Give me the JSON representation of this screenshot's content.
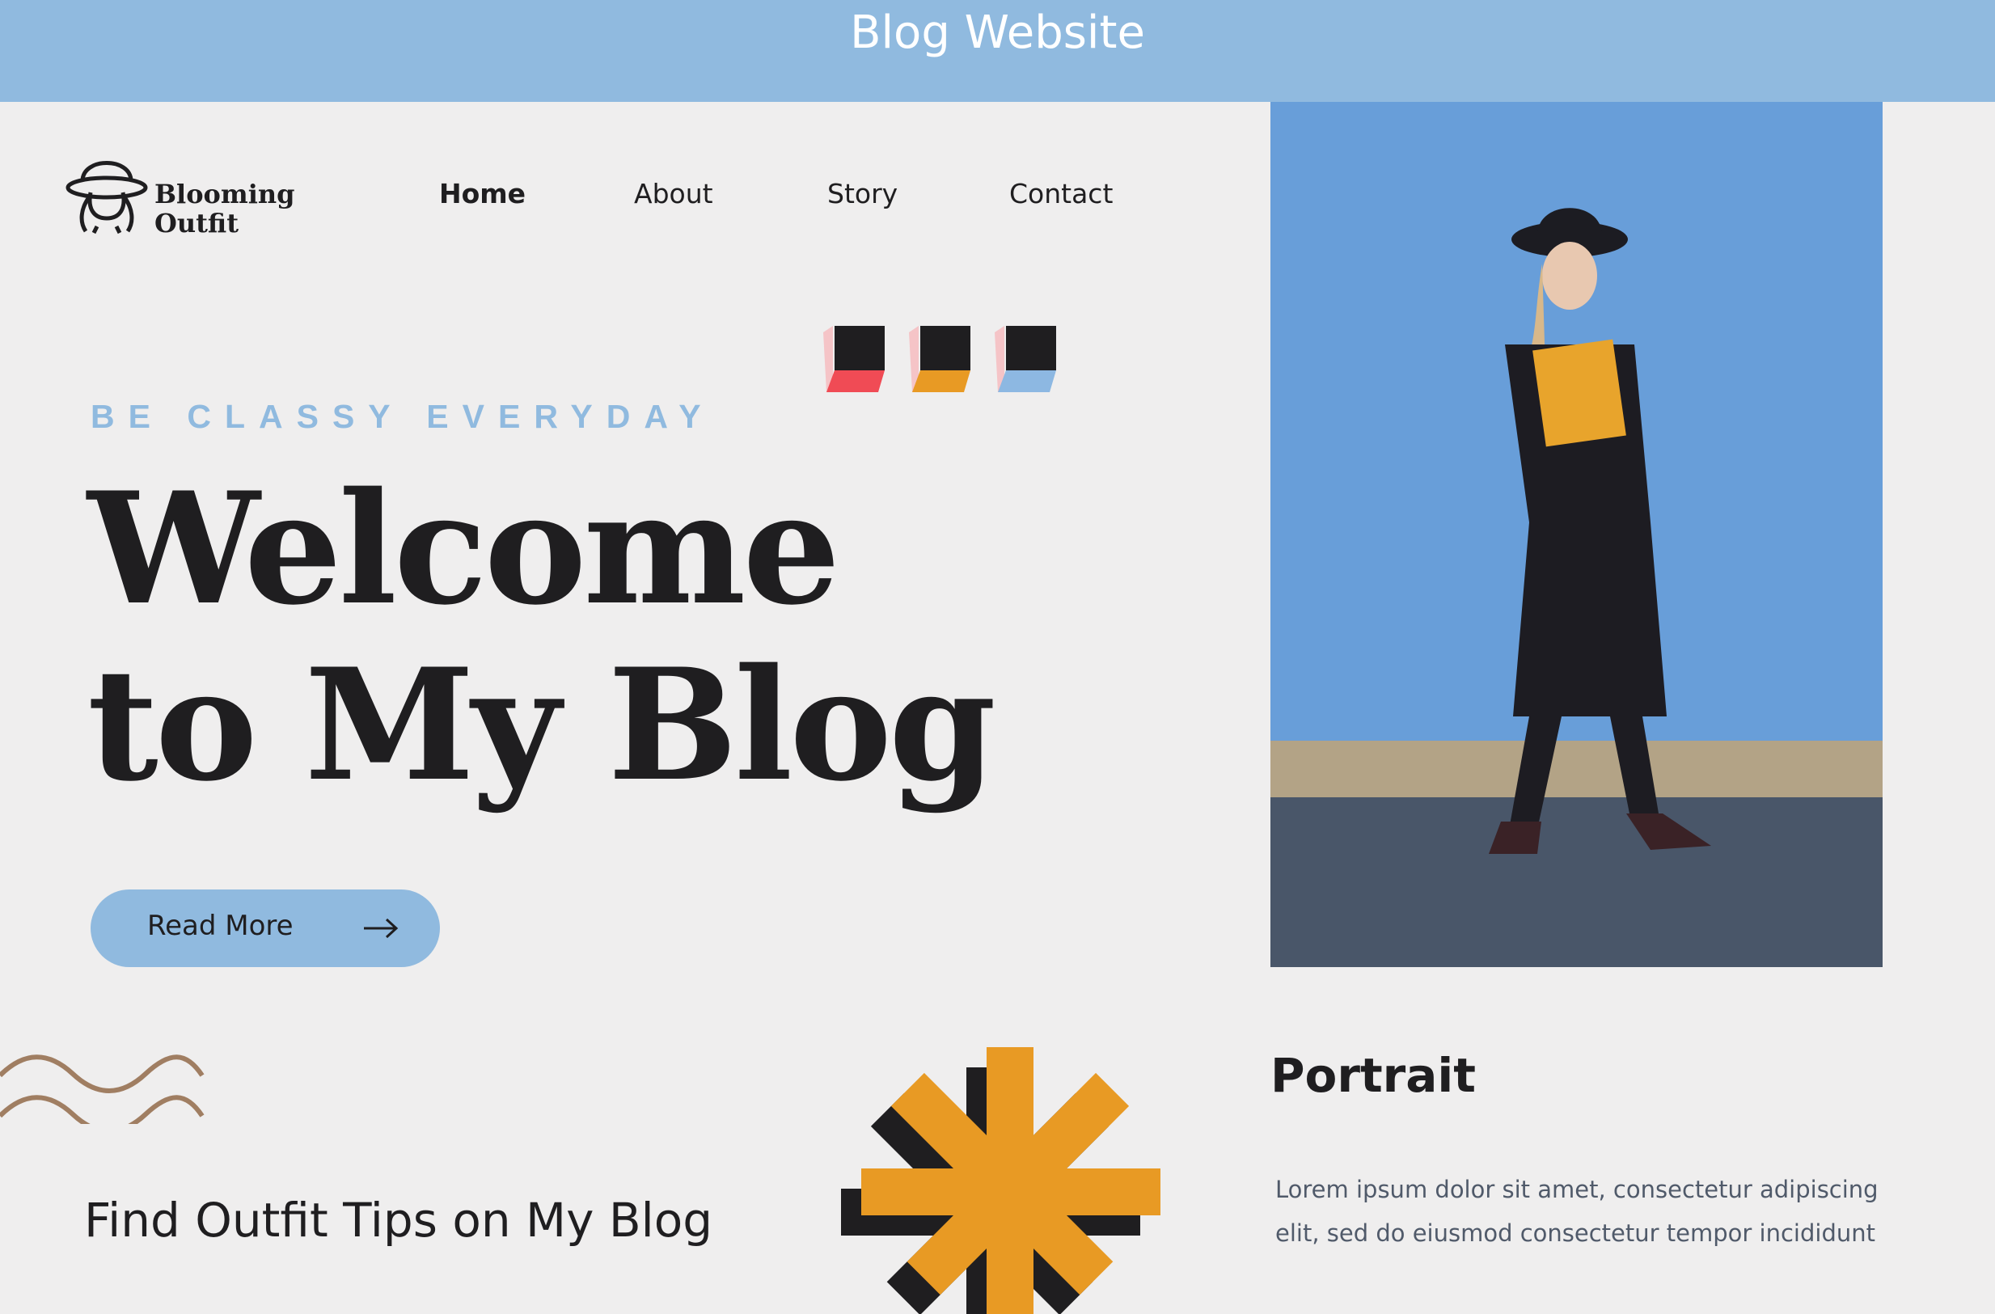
{
  "window": {
    "title": "Blog Website"
  },
  "logo": {
    "line1": "Blooming",
    "line2": "Outfit"
  },
  "nav": {
    "items": [
      "Home",
      "About",
      "Story",
      "Contact"
    ],
    "active": "Home"
  },
  "hero": {
    "tagline": "BE CLASSY EVERYDAY",
    "headline_line1": "Welcome",
    "headline_line2": "to My Blog",
    "cta_label": "Read More"
  },
  "cube_colors": [
    "#f04b55",
    "#e89a24",
    "#8db8e2"
  ],
  "section": {
    "heading": "Find Outfit Tips on My Blog"
  },
  "portrait": {
    "title": "Portrait",
    "text": "Lorem ipsum dolor sit amet, consectetur adipiscing elit, sed do eiusmod consectetur tempor incididunt"
  },
  "colors": {
    "accent_blue": "#90badf",
    "dark": "#1f1e20",
    "orange": "#e89a24",
    "wave": "#a07e62"
  }
}
